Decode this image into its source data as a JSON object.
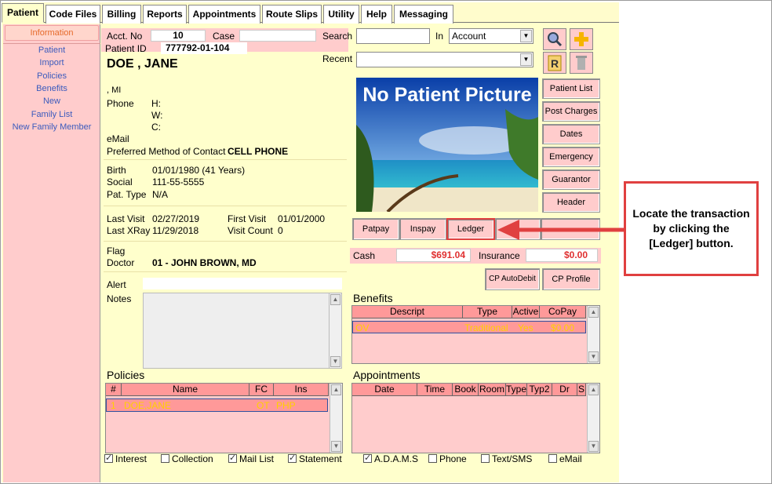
{
  "tabs": [
    "Patient",
    "Code Files",
    "Billing",
    "Reports",
    "Appointments",
    "Route Slips",
    "Utility",
    "Help",
    "Messaging"
  ],
  "sidebar": {
    "header": "Information",
    "items": [
      "Patient",
      "Import",
      "Policies",
      "Benefits",
      "New",
      "Family List",
      "New Family Member"
    ]
  },
  "patient": {
    "acct_label": "Acct. No",
    "acct_value": "10",
    "case_label": "Case",
    "case_value": "",
    "id_label": "Patient ID",
    "id_value": "777792-01-104",
    "name": "DOE , JANE",
    "mi": ", MI",
    "phone_label": "Phone",
    "phone_h": "H:",
    "phone_w": "W:",
    "phone_c": "C:",
    "email_label": "eMail",
    "contact_label": "Preferred Method of Contact",
    "contact_value": "CELL PHONE",
    "birth_label": "Birth",
    "birth_value": "01/01/1980 (41 Years)",
    "social_label": "Social",
    "social_value": "111-55-5555",
    "pattype_label": "Pat. Type",
    "pattype_value": "N/A",
    "lastvisit_label": "Last Visit",
    "lastvisit_value": "02/27/2019",
    "firstvisit_label": "First Visit",
    "firstvisit_value": "01/01/2000",
    "lastxray_label": "Last XRay",
    "lastxray_value": "11/29/2018",
    "visitcount_label": "Visit Count",
    "visitcount_value": "0",
    "flag_label": "Flag",
    "doctor_label": "Doctor",
    "doctor_value": "01 - JOHN BROWN, MD",
    "alert_label": "Alert",
    "notes_label": "Notes"
  },
  "search": {
    "label": "Search",
    "value": "",
    "in_label": "In",
    "in_value": "Account",
    "recent_label": "Recent",
    "recent_value": ""
  },
  "picture": {
    "text": "No Patient Picture"
  },
  "right_buttons": [
    "Patient List",
    "Post Charges",
    "Dates",
    "Emergency",
    "Guarantor",
    "Header"
  ],
  "pay_buttons": [
    "Patpay",
    "Inspay",
    "Ledger"
  ],
  "money": {
    "cash_label": "Cash",
    "cash_value": "$691.04",
    "insurance_label": "Insurance",
    "insurance_value": "$0.00"
  },
  "cp_buttons": [
    "CP AutoDebit",
    "CP Profile"
  ],
  "benefits": {
    "title": "Benefits",
    "columns": [
      "Descript",
      "Type",
      "Active",
      "CoPay"
    ],
    "rows": [
      [
        "OV",
        "Traditional",
        "Yes",
        "$0.00"
      ]
    ]
  },
  "policies": {
    "title": "Policies",
    "columns": [
      "#",
      "Name",
      "FC",
      "Ins"
    ],
    "rows": [
      [
        "1",
        "DOE,JANE",
        "OT",
        "PHP"
      ]
    ]
  },
  "appointments": {
    "title": "Appointments",
    "columns": [
      "Date",
      "Time",
      "Book",
      "Room",
      "Type",
      "Typ2",
      "Dr",
      "S"
    ]
  },
  "checks_left": [
    {
      "label": "Interest",
      "checked": true
    },
    {
      "label": "Collection",
      "checked": false
    },
    {
      "label": "Mail List",
      "checked": true
    },
    {
      "label": "Statement",
      "checked": true
    }
  ],
  "checks_right": [
    {
      "label": "A.D.A.M.S",
      "checked": true
    },
    {
      "label": "Phone",
      "checked": false
    },
    {
      "label": "Text/SMS",
      "checked": false
    },
    {
      "label": "eMail",
      "checked": false
    }
  ],
  "callout": {
    "text": "Locate the transaction by clicking the [Ledger] button.",
    "color": "#e04040"
  },
  "icons": [
    "search-icon",
    "add-icon",
    "report-icon",
    "trash-icon"
  ]
}
